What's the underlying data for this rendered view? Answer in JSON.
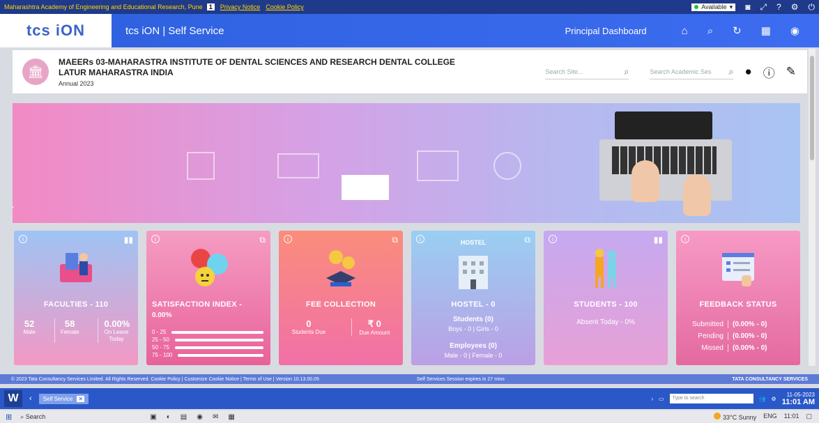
{
  "top_strip": {
    "org": "Maharashtra Academy of Engineering and Educational Research, Pune",
    "icon_badge": "1",
    "privacy": "Privacy Notice",
    "cookie": "Cookie Policy",
    "status": "Available"
  },
  "header": {
    "logo": "tcs iON",
    "app_title": "tcs iON | Self Service",
    "dashboard": "Principal Dashboard"
  },
  "institute": {
    "name_line1": "MAEERs 03-MAHARASTRA INSTITUTE OF DENTAL SCIENCES AND RESEARCH DENTAL COLLEGE",
    "name_line2": "LATUR MAHARASTRA INDIA",
    "year": "Annual 2023",
    "search_site_placeholder": "Search Site...",
    "search_session_placeholder": "Search Academic Ses"
  },
  "cards": {
    "faculties": {
      "title": "FACULTIES - 110",
      "stats": [
        {
          "value": "52",
          "label": "Male"
        },
        {
          "value": "58",
          "label": "Female"
        },
        {
          "value": "0.00%",
          "label": "On Leave Today"
        }
      ]
    },
    "satisfaction": {
      "title": "SATISFACTION INDEX -",
      "value": "0.00%",
      "ranges": [
        "0 - 25",
        "25 - 50",
        "50 - 75",
        "75 - 100"
      ]
    },
    "fee": {
      "title": "FEE COLLECTION",
      "stats": [
        {
          "value": "0",
          "label": "Students Due"
        },
        {
          "value": "₹ 0",
          "label": "Due Amount"
        }
      ]
    },
    "hostel": {
      "art_label": "HOSTEL",
      "title": "HOSTEL - 0",
      "students": "Students (0)",
      "students_detail": "Boys - 0 | Girls - 0",
      "employees": "Employees (0)",
      "employees_detail": "Male - 0 | Female - 0"
    },
    "students": {
      "title": "STUDENTS - 100",
      "absent": "Absent Today - 0%"
    },
    "feedback": {
      "title": "FEEDBACK STATUS",
      "rows": [
        {
          "key": "Submitted",
          "value": "(0.00% - 0)"
        },
        {
          "key": "Pending",
          "value": "(0.00% - 0)"
        },
        {
          "key": "Missed",
          "value": "(0.00% - 0)"
        }
      ]
    }
  },
  "footer": {
    "left": "© 2023 Tata Consultancy Services Limited. All Rights Reserved.   Cookie Policy | Customize Cookie Notice | Terms of Use | Version 10.13.00.05",
    "mid": "Self Services Session expires in 27 mins",
    "right": "TATA CONSULTANCY SERVICES"
  },
  "browser_taskbar": {
    "tab": "Self Service",
    "search_placeholder": "Type to search",
    "date": "11-05-2023",
    "time": "11:01 AM"
  },
  "windows_taskbar": {
    "search": "Search",
    "weather": "33°C  Sunny",
    "lang": "ENG",
    "time": "11:01"
  },
  "colors": {
    "header_blue": "#3d6cf0",
    "footer_blue": "#5d7bd6",
    "logo_pink": "#e23b82"
  }
}
